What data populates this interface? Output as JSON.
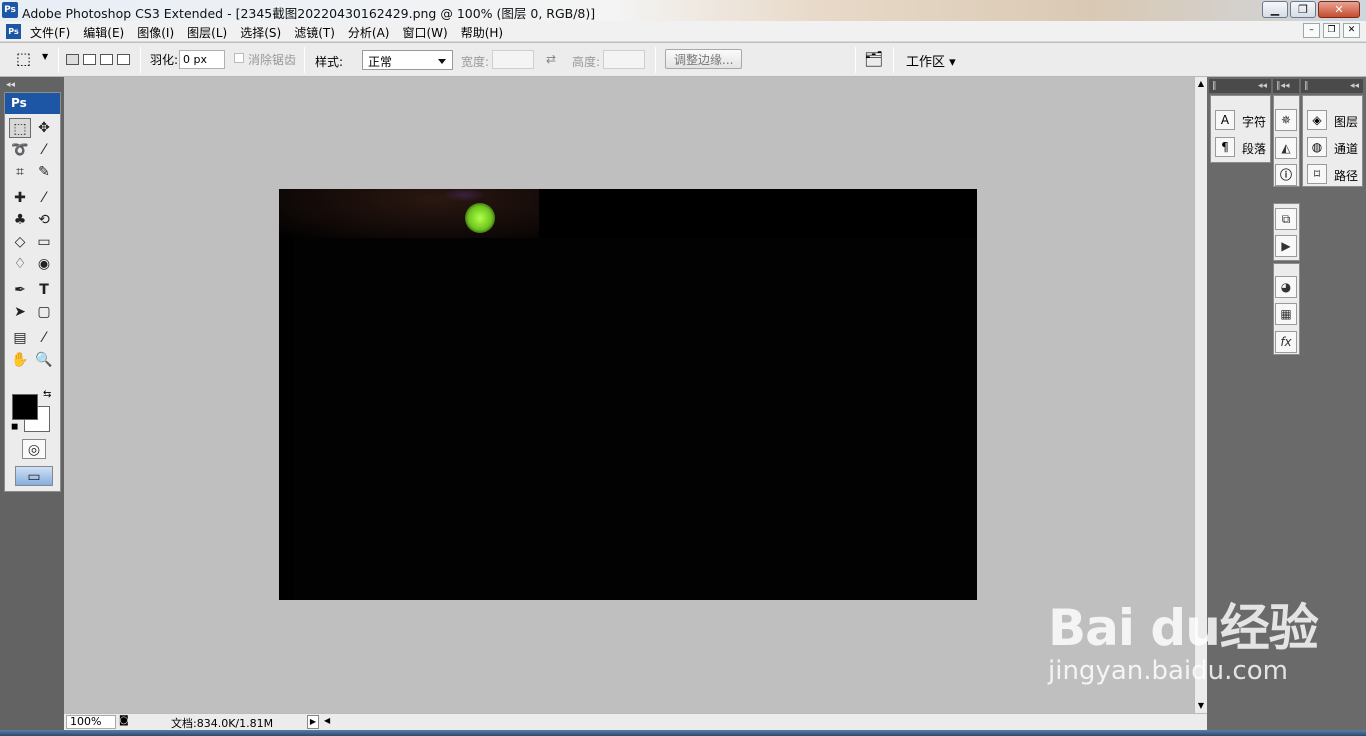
{
  "window": {
    "title": "Adobe Photoshop CS3 Extended - [2345截图20220430162429.png @ 100% (图层 0, RGB/8)]",
    "app_icon": "Ps",
    "controls": [
      "minimize-icon",
      "maximize-icon",
      "close-icon"
    ]
  },
  "menubar": {
    "items": [
      "文件(F)",
      "编辑(E)",
      "图像(I)",
      "图层(L)",
      "选择(S)",
      "滤镜(T)",
      "分析(A)",
      "窗口(W)",
      "帮助(H)"
    ]
  },
  "options": {
    "feather_label": "羽化:",
    "feather_value": "0 px",
    "antialias_label": "消除锯齿",
    "style_label": "样式:",
    "style_value": "正常",
    "width_label": "宽度:",
    "height_label": "高度:",
    "refine_button": "调整边缘...",
    "workspace_button": "工作区 ▾"
  },
  "toolbox": {
    "logo": "Ps",
    "selected_tool": "rectangular-marquee",
    "foreground_color": "#000000",
    "background_color": "#ffffff"
  },
  "document": {
    "zoom": "100%",
    "doc_size": "文档:834.0K/1.81M"
  },
  "panels": {
    "group1": [
      "字符",
      "段落"
    ],
    "group3": [
      "图层",
      "通道",
      "路径"
    ]
  },
  "watermark": {
    "brand": "Bai du经验",
    "url": "jingyan.baidu.com"
  },
  "colors": {
    "ps_blue": "#1c56a5",
    "dock_gray": "#636363",
    "canvas_gray": "#bfbfbf"
  }
}
